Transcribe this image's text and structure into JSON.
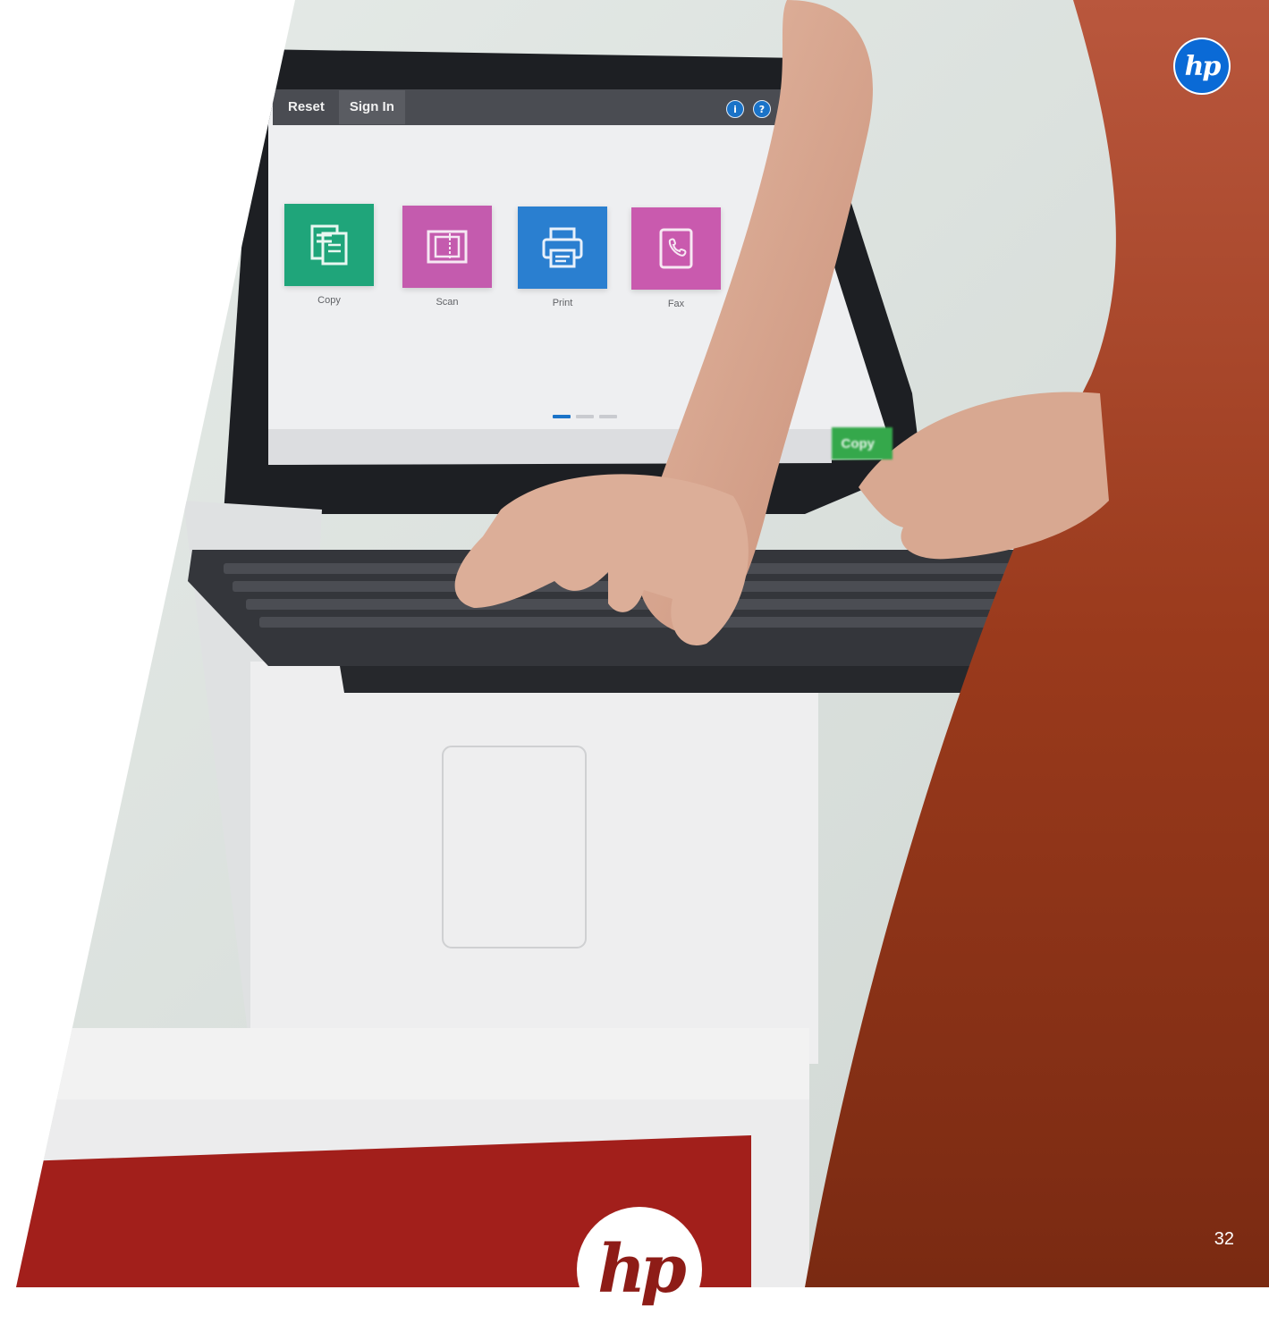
{
  "panel": {
    "header_buttons": [
      "Reset",
      "Sign In"
    ],
    "header_icons": [
      "info-icon",
      "help-icon"
    ],
    "apps": [
      {
        "label": "Copy",
        "icon": "copy-icon",
        "color": "#1fa57a"
      },
      {
        "label": "Scan",
        "icon": "scan-icon",
        "color": "#c45bae"
      },
      {
        "label": "Print",
        "icon": "print-icon",
        "color": "#2a7fd0"
      },
      {
        "label": "Fax",
        "icon": "fax-icon",
        "color": "#c95aae"
      }
    ],
    "pager_active_index": 0,
    "pager_count": 3,
    "start_button_label": "Copy"
  },
  "logo": {
    "text": "hp",
    "color": "#0a6ad6"
  },
  "page_number": "32"
}
